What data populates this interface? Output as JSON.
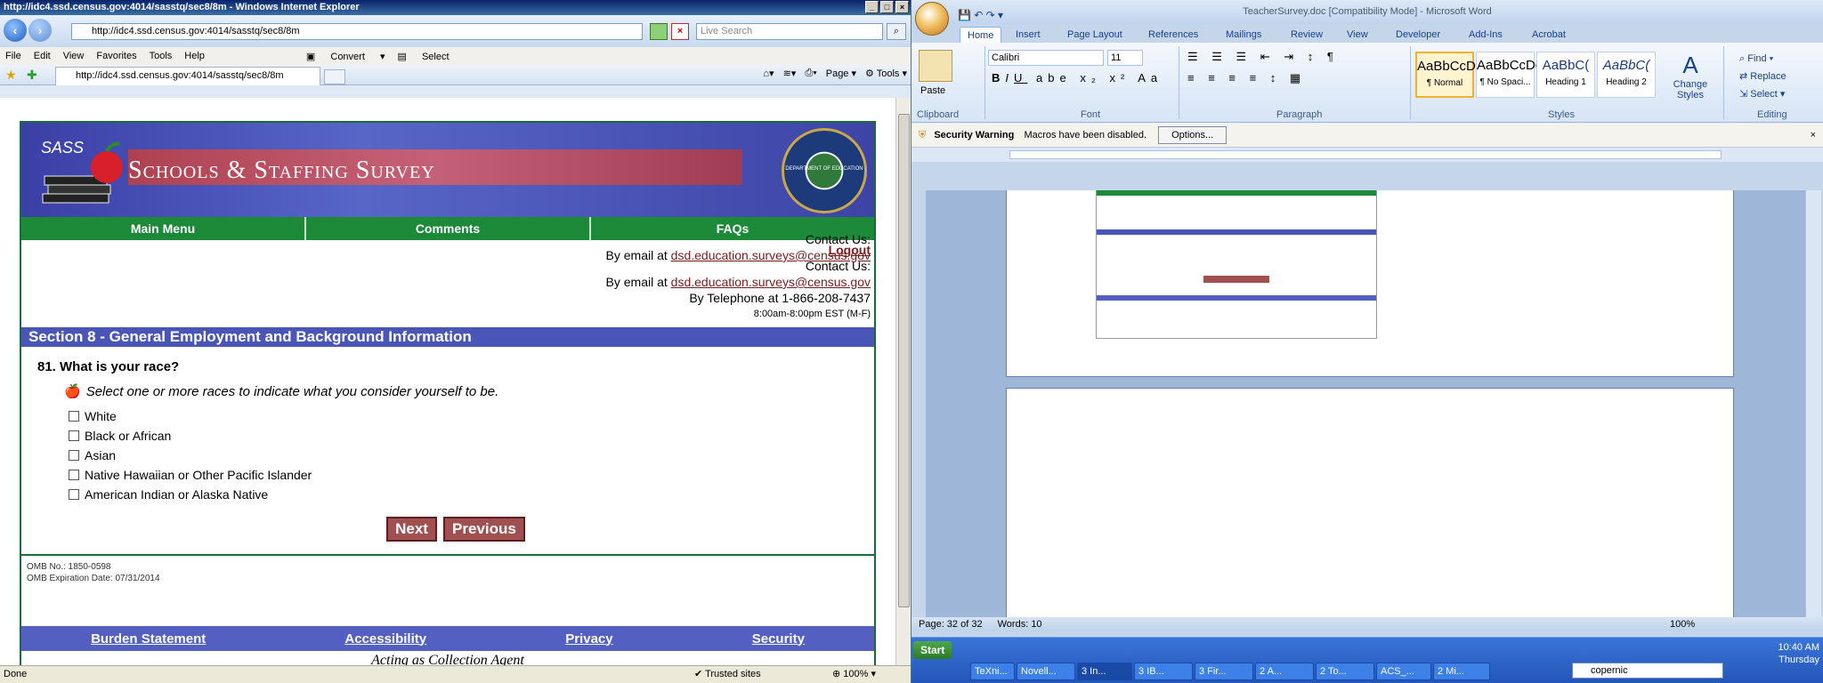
{
  "ie": {
    "title": "http://idc4.ssd.census.gov:4014/sasstq/sec8/8m - Windows Internet Explorer",
    "address": "http://idc4.ssd.census.gov:4014/sasstq/sec8/8m",
    "search_placeholder": "Live Search",
    "menu": [
      "File",
      "Edit",
      "View",
      "Favorites",
      "Tools",
      "Help"
    ],
    "convert_label": "Convert",
    "select_label": "Select",
    "tab_title": "http://idc4.ssd.census.gov:4014/sasstq/sec8/8m",
    "cmd": [
      "Page",
      "Tools"
    ],
    "status_left": "Done",
    "status_zone": "Trusted sites",
    "zoom": "100%"
  },
  "page": {
    "banner_logo": "SASS",
    "banner_title": "Schools & Staffing Survey",
    "seal_text": "DEPARTMENT OF EDUCATION",
    "nav": [
      "Main Menu",
      "Comments",
      "FAQs"
    ],
    "logout": "Logout",
    "contact_label": "Contact Us:",
    "email_prefix": "By email at",
    "email": "dsd.education.surveys@census.gov",
    "phone": "By Telephone at 1-866-208-7437",
    "hours": "8:00am-8:00pm EST (M-F)",
    "section": "Section 8 - General Employment and Background Information",
    "overlap_contact": "Contact Us:",
    "overlap_email_prefix": "By email at",
    "overlap_email": "dsd.education.surveys@census.gov",
    "question": "81. What is your race?",
    "instruction": "Select one or more races to indicate what you consider yourself to be.",
    "options": [
      "White",
      "Black or African",
      "Asian",
      "Native Hawaiian or Other Pacific Islander",
      "American Indian or Alaska Native"
    ],
    "next": "Next",
    "previous": "Previous",
    "omb_no": "OMB No.: 1850-0598",
    "omb_exp": "OMB Expiration Date: 07/31/2014",
    "footer": [
      "Burden Statement",
      "Accessibility",
      "Privacy",
      "Security"
    ],
    "agent": "Acting as Collection Agent"
  },
  "word": {
    "title": "TeacherSurvey.doc [Compatibility Mode] - Microsoft Word",
    "tabs": [
      "Home",
      "Insert",
      "Page Layout",
      "References",
      "Mailings",
      "Review",
      "View",
      "Developer",
      "Add-Ins",
      "Acrobat"
    ],
    "font_name": "Calibri",
    "font_size": "11",
    "paste": "Paste",
    "groups": [
      "Clipboard",
      "Font",
      "Paragraph",
      "Styles",
      "Editing"
    ],
    "styles": [
      {
        "preview": "AaBbCcDc",
        "name": "¶ Normal"
      },
      {
        "preview": "AaBbCcDc",
        "name": "¶ No Spaci..."
      },
      {
        "preview": "AaBbC(",
        "name": "Heading 1"
      },
      {
        "preview": "AaBbC(",
        "name": "Heading 2"
      }
    ],
    "change_styles": "Change Styles",
    "editing": [
      "Find",
      "Replace",
      "Select"
    ],
    "warning_title": "Security Warning",
    "warning_text": "Macros have been disabled.",
    "options_button": "Options...",
    "status_page": "Page: 32 of 32",
    "status_words": "Words: 10",
    "zoom": "100%"
  },
  "taskbar": {
    "start": "Start",
    "tasks": [
      "TeXni...",
      "Novell...",
      "3 In...",
      "3 IB...",
      "3 Fir...",
      "2 A...",
      "2 To...",
      "ACS_...",
      "2 Mi..."
    ],
    "search": "copernic",
    "time": "10:40 AM",
    "day": "Thursday"
  }
}
